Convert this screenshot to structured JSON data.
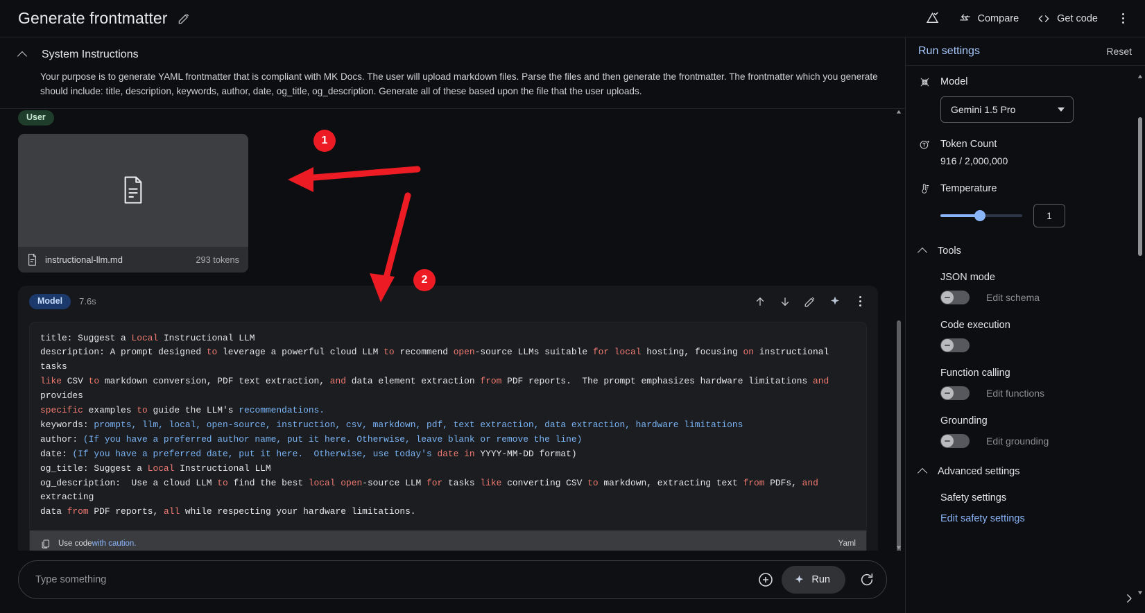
{
  "topbar": {
    "title": "Generate frontmatter",
    "edit_icon": "pencil-icon",
    "tune_icon": "tune-prompt-icon",
    "compare_label": "Compare",
    "compare_icon": "compare-icon",
    "get_code_label": "Get code",
    "get_code_icon": "code-brackets-icon",
    "more_icon": "kebab-menu-icon"
  },
  "system_instructions": {
    "heading": "System Instructions",
    "collapse_icon": "chevron-up-icon",
    "text": "Your purpose is to generate YAML frontmatter that is compliant with MK Docs. The user will upload markdown files. Parse the files and then generate the frontmatter. The frontmatter which you generate should include: title, description, keywords, author, date, og_title, og_description.  Generate all of these based upon the file that the user uploads."
  },
  "conversation": {
    "user": {
      "role_label": "User",
      "file": {
        "name": "instructional-llm.md",
        "tokens": "293 tokens",
        "thumb_icon": "document-icon",
        "meta_icon": "document-icon"
      }
    },
    "model": {
      "role_label": "Model",
      "duration": "7.6s",
      "actions": [
        {
          "name": "move-up-icon"
        },
        {
          "name": "move-down-icon"
        },
        {
          "name": "edit-icon"
        },
        {
          "name": "sparkle-icon"
        },
        {
          "name": "kebab-menu-icon"
        }
      ],
      "code": {
        "language_label": "Yaml",
        "caution_prefix": "Use code ",
        "caution_link": "with caution.",
        "copy_icon": "copy-icon",
        "lines": [
          [
            {
              "t": "title: Suggest a ",
              "c": ""
            },
            {
              "t": "Local",
              "c": "kw"
            },
            {
              "t": " Instructional LLM",
              "c": ""
            }
          ],
          [
            {
              "t": "description: A prompt designed ",
              "c": ""
            },
            {
              "t": "to",
              "c": "kw"
            },
            {
              "t": " leverage a powerful cloud LLM ",
              "c": ""
            },
            {
              "t": "to",
              "c": "kw"
            },
            {
              "t": " recommend ",
              "c": ""
            },
            {
              "t": "open",
              "c": "kw"
            },
            {
              "t": "-source LLMs suitable ",
              "c": ""
            },
            {
              "t": "for",
              "c": "kw"
            },
            {
              "t": " ",
              "c": ""
            },
            {
              "t": "local",
              "c": "kw"
            },
            {
              "t": " hosting, focusing ",
              "c": ""
            },
            {
              "t": "on",
              "c": "kw"
            },
            {
              "t": " instructional tasks",
              "c": ""
            }
          ],
          [
            {
              "t": "like",
              "c": "kw"
            },
            {
              "t": " CSV ",
              "c": ""
            },
            {
              "t": "to",
              "c": "kw"
            },
            {
              "t": " markdown conversion, PDF text extraction, ",
              "c": ""
            },
            {
              "t": "and",
              "c": "kw"
            },
            {
              "t": " data element extraction ",
              "c": ""
            },
            {
              "t": "from",
              "c": "kw"
            },
            {
              "t": " PDF reports.  The prompt emphasizes hardware limitations ",
              "c": ""
            },
            {
              "t": "and",
              "c": "kw"
            },
            {
              "t": " provides",
              "c": ""
            }
          ],
          [
            {
              "t": "specific",
              "c": "kw"
            },
            {
              "t": " examples ",
              "c": ""
            },
            {
              "t": "to",
              "c": "kw"
            },
            {
              "t": " guide the LLM's ",
              "c": ""
            },
            {
              "t": "recommendations.",
              "c": "st"
            }
          ],
          [
            {
              "t": "keywords: ",
              "c": ""
            },
            {
              "t": "prompts, llm, local, open-source, instruction, csv, markdown, pdf, text extraction, data extraction, hardware limitations",
              "c": "st"
            }
          ],
          [
            {
              "t": "author: ",
              "c": ""
            },
            {
              "t": "(If you have a preferred author name, put it here. Otherwise, leave blank or remove the line)",
              "c": "st"
            }
          ],
          [
            {
              "t": "date: ",
              "c": ""
            },
            {
              "t": "(If you have a preferred date, put it here.  Otherwise, use today's ",
              "c": "st"
            },
            {
              "t": "date",
              "c": "kw"
            },
            {
              "t": " ",
              "c": ""
            },
            {
              "t": "in",
              "c": "kw"
            },
            {
              "t": " YYYY-MM-DD format)",
              "c": ""
            }
          ],
          [
            {
              "t": "og_title: Suggest a ",
              "c": ""
            },
            {
              "t": "Local",
              "c": "kw"
            },
            {
              "t": " Instructional LLM",
              "c": ""
            }
          ],
          [
            {
              "t": "og_description:  Use a cloud LLM ",
              "c": ""
            },
            {
              "t": "to",
              "c": "kw"
            },
            {
              "t": " find the best ",
              "c": ""
            },
            {
              "t": "local",
              "c": "kw"
            },
            {
              "t": " ",
              "c": ""
            },
            {
              "t": "open",
              "c": "kw"
            },
            {
              "t": "-source LLM ",
              "c": ""
            },
            {
              "t": "for",
              "c": "kw"
            },
            {
              "t": " tasks ",
              "c": ""
            },
            {
              "t": "like",
              "c": "kw"
            },
            {
              "t": " converting CSV ",
              "c": ""
            },
            {
              "t": "to",
              "c": "kw"
            },
            {
              "t": " markdown, extracting text ",
              "c": ""
            },
            {
              "t": "from",
              "c": "kw"
            },
            {
              "t": " PDFs, ",
              "c": ""
            },
            {
              "t": "and",
              "c": "kw"
            },
            {
              "t": " extracting",
              "c": ""
            }
          ],
          [
            {
              "t": "data ",
              "c": ""
            },
            {
              "t": "from",
              "c": "kw"
            },
            {
              "t": " PDF reports, ",
              "c": ""
            },
            {
              "t": "all",
              "c": "kw"
            },
            {
              "t": " while respecting your hardware limitations.",
              "c": ""
            }
          ]
        ]
      },
      "feedback": {
        "thumb_up_icon": "thumb-up-icon",
        "thumb_down_icon": "thumb-down-icon"
      }
    }
  },
  "composer": {
    "placeholder": "Type something",
    "value": "",
    "add_icon": "plus-circle-icon",
    "run_label": "Run",
    "run_icon": "sparkle-icon",
    "refresh_icon": "refresh-icon"
  },
  "run_settings": {
    "title": "Run settings",
    "reset_label": "Reset",
    "model": {
      "icon": "model-atom-icon",
      "label": "Model",
      "selected": "Gemini 1.5 Pro",
      "caret_icon": "chevron-down-icon"
    },
    "token_count": {
      "icon": "token-count-icon",
      "label": "Token Count",
      "value": "916 / 2,000,000"
    },
    "temperature": {
      "icon": "thermometer-icon",
      "label": "Temperature",
      "value": "1"
    },
    "tools": {
      "heading": "Tools",
      "collapse_icon": "chevron-up-icon",
      "items": [
        {
          "name": "JSON mode",
          "toggle": false,
          "link": "Edit schema"
        },
        {
          "name": "Code execution",
          "toggle": false,
          "link": ""
        },
        {
          "name": "Function calling",
          "toggle": false,
          "link": "Edit functions"
        },
        {
          "name": "Grounding",
          "toggle": false,
          "link": "Edit grounding"
        }
      ]
    },
    "advanced": {
      "heading": "Advanced settings",
      "collapse_icon": "chevron-up-icon",
      "safety_label": "Safety settings",
      "safety_link": "Edit safety settings"
    },
    "expand_icon": "chevron-right-icon"
  },
  "annotations": [
    {
      "number": "1",
      "color": "#ed1c24"
    },
    {
      "number": "2",
      "color": "#ed1c24"
    }
  ]
}
